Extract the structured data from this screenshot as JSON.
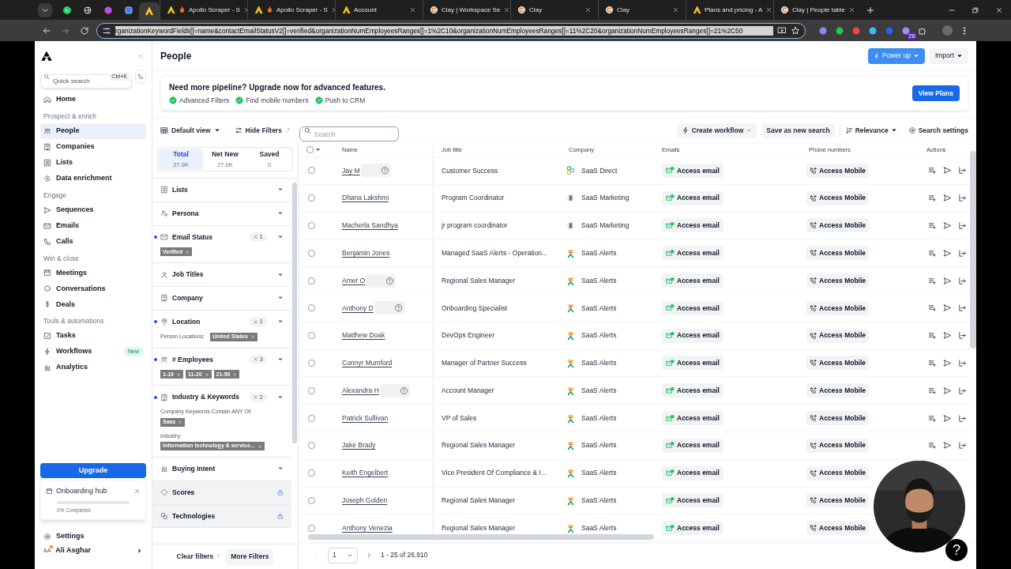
{
  "browser": {
    "pinned_tabs": [
      {
        "selected": false
      },
      {
        "selected": false
      },
      {
        "selected": false
      },
      {
        "selected": false
      },
      {
        "selected": true
      }
    ],
    "tabs": [
      {
        "title": "Apollo Scraper - S",
        "kind": "apollo-flame"
      },
      {
        "title": "Apollo Scraper - S",
        "kind": "apollo-flame"
      },
      {
        "title": "Account",
        "kind": "apollo"
      },
      {
        "title": "Clay | Workspace Se",
        "kind": "clay"
      },
      {
        "title": "Clay",
        "kind": "clay"
      },
      {
        "title": "Clay",
        "kind": "clay"
      },
      {
        "title": "Plans and pricing - A",
        "kind": "apollo"
      },
      {
        "title": "Clay | People table",
        "kind": "clay"
      }
    ],
    "url": "rganizationKeywordFields[]=name&contactEmailStatusV2[]=verified&organizationNumEmployeesRanges[]=1%2C10&organizationNumEmployeesRanges[]=11%2C20&organizationNumEmployeesRanges[]=21%2C50",
    "extension_badge": "26"
  },
  "sidebar": {
    "search": {
      "placeholder": "Quick search",
      "shortcut": "Ctrl+K"
    },
    "groups": [
      {
        "items": [
          {
            "label": "Home",
            "selected": false
          }
        ]
      },
      {
        "heading": "Prospect & enrich",
        "items": [
          {
            "label": "People",
            "selected": true
          },
          {
            "label": "Companies",
            "selected": false
          },
          {
            "label": "Lists",
            "selected": false
          },
          {
            "label": "Data enrichment",
            "selected": false
          }
        ]
      },
      {
        "heading": "Engage",
        "items": [
          {
            "label": "Sequences",
            "selected": false
          },
          {
            "label": "Emails",
            "selected": false
          },
          {
            "label": "Calls",
            "selected": false
          }
        ]
      },
      {
        "heading": "Win & close",
        "items": [
          {
            "label": "Meetings",
            "selected": false
          },
          {
            "label": "Conversations",
            "selected": false
          },
          {
            "label": "Deals",
            "selected": false
          }
        ]
      },
      {
        "heading": "Tools & automations",
        "items": [
          {
            "label": "Tasks",
            "selected": false
          },
          {
            "label": "Workflows",
            "selected": false,
            "badge": "New"
          },
          {
            "label": "Analytics",
            "selected": false
          }
        ]
      }
    ],
    "upgrade_button": "Upgrade",
    "onboarding": {
      "title": "Onboarding hub",
      "level": 0,
      "progress_text": "0% Completed"
    },
    "settings": "Settings",
    "user": {
      "initials": "AA",
      "name": "Ali Asghar"
    }
  },
  "header": {
    "title": "People",
    "power_up": "Power up",
    "import": "Import"
  },
  "banner": {
    "text": "Need more pipeline? Upgrade now for advanced features.",
    "features": [
      "Advanced Filters",
      "Find mobile numbers",
      "Push to CRM"
    ],
    "button": "View Plans"
  },
  "toolbar": {
    "view": "Default view",
    "hide_filters": "Hide Filters",
    "hide_filters_count": "7",
    "search_placeholder": "Search",
    "create_workflow": "Create workflow",
    "save_search": "Save as new search",
    "sort": "Relevance",
    "settings": "Search settings"
  },
  "stats": [
    {
      "label": "Total",
      "value": "27.0K",
      "selected": true
    },
    {
      "label": "Net New",
      "value": "27.0K",
      "selected": false
    },
    {
      "label": "Saved",
      "value": "0",
      "selected": false
    }
  ],
  "filters": [
    {
      "label": "Lists",
      "active": false,
      "locked": false
    },
    {
      "label": "Persona",
      "active": false,
      "locked": false
    },
    {
      "label": "Email Status",
      "active": true,
      "count": "1",
      "locked": false,
      "groups": [
        {
          "kind": "inline",
          "chips": [
            "Verified"
          ]
        }
      ]
    },
    {
      "label": "Job Titles",
      "active": false,
      "locked": false
    },
    {
      "label": "Company",
      "active": false,
      "locked": false
    },
    {
      "label": "Location",
      "active": true,
      "count": "1",
      "locked": false,
      "groups": [
        {
          "kind": "inline",
          "label": "Person Locations:",
          "chips": [
            "United States"
          ]
        }
      ]
    },
    {
      "label": "# Employees",
      "active": true,
      "count": "3",
      "locked": false,
      "groups": [
        {
          "kind": "inline",
          "chips": [
            "1-10",
            "11-20",
            "21-50"
          ]
        }
      ]
    },
    {
      "label": "Industry & Keywords",
      "active": true,
      "count": "2",
      "locked": false,
      "groups": [
        {
          "kind": "stacked",
          "label": "Company Keywords Contain ANY Of:",
          "chips": [
            "Saas"
          ]
        },
        {
          "kind": "stacked",
          "label": "Industry:",
          "chips": [
            "information technology & service..."
          ]
        }
      ]
    },
    {
      "label": "Buying Intent",
      "active": false,
      "locked": false
    },
    {
      "label": "Scores",
      "active": false,
      "locked": true
    },
    {
      "label": "Technologies",
      "active": false,
      "locked": true
    }
  ],
  "filter_footer": {
    "clear": "Clear filters",
    "clear_count": "7",
    "more": "More Filters"
  },
  "table": {
    "select_all": {
      "checked": false
    },
    "columns": [
      "Name",
      "Job title",
      "Company",
      "Emails",
      "Phone numbers",
      "Actions"
    ],
    "rows": [
      {
        "checked": false,
        "name": "Jay M",
        "blurred": true,
        "job": "Customer Success",
        "company": "SaaS Direct",
        "kind": "rings",
        "email": "Access email",
        "phone": "Access Mobile",
        "covered": false
      },
      {
        "checked": false,
        "name": "Dhana Lakshmi",
        "blurred": false,
        "job": "Program Coordinator",
        "company": "SaaS Marketing",
        "kind": "building",
        "email": "Access email",
        "phone": "Access Mobile",
        "covered": false
      },
      {
        "checked": false,
        "name": "Macherla Sandhya",
        "blurred": false,
        "job": "jr program coordinator",
        "company": "SaaS Marketing",
        "kind": "building",
        "email": "Access email",
        "phone": "Access Mobile",
        "covered": false
      },
      {
        "checked": false,
        "name": "Benjamin Jones",
        "blurred": false,
        "job": "Managed SaaS Alerts - Operation...",
        "company": "SaaS Alerts",
        "kind": "alerts",
        "email": "Access email",
        "phone": "Access Mobile",
        "covered": false
      },
      {
        "checked": false,
        "name": "Amer O",
        "blurred": true,
        "job": "Regional Sales Manager",
        "company": "SaaS Alerts",
        "kind": "alerts",
        "email": "Access email",
        "phone": "Access Mobile",
        "covered": false
      },
      {
        "checked": false,
        "name": "Anthony D",
        "blurred": true,
        "job": "Onboarding Specialist",
        "company": "SaaS Alerts",
        "kind": "alerts",
        "email": "Access email",
        "phone": "Access Mobile",
        "covered": false
      },
      {
        "checked": false,
        "name": "Matthew Doak",
        "blurred": false,
        "job": "DevOps Engineer",
        "company": "SaaS Alerts",
        "kind": "alerts",
        "email": "Access email",
        "phone": "Access Mobile",
        "covered": false
      },
      {
        "checked": false,
        "name": "Connyr Mumford",
        "blurred": false,
        "job": "Manager of Partner Success",
        "company": "SaaS Alerts",
        "kind": "alerts",
        "email": "Access email",
        "phone": "Access Mobile",
        "covered": false
      },
      {
        "checked": false,
        "name": "Alexandra H",
        "blurred": true,
        "job": "Account Manager",
        "company": "SaaS Alerts",
        "kind": "alerts",
        "email": "Access email",
        "phone": "Access Mobile",
        "covered": false
      },
      {
        "checked": false,
        "name": "Patrick Sullivan",
        "blurred": false,
        "job": "VP of Sales",
        "company": "SaaS Alerts",
        "kind": "alerts",
        "email": "Access email",
        "phone": "Access Mobile",
        "covered": false
      },
      {
        "checked": false,
        "name": "Jake Brady",
        "blurred": false,
        "job": "Regional Sales Manager",
        "company": "SaaS Alerts",
        "kind": "alerts",
        "email": "Access email",
        "phone": "Access Mobile",
        "covered": false
      },
      {
        "checked": false,
        "name": "Keith Engelbert",
        "blurred": false,
        "job": "Vice President Of Compliance & I...",
        "company": "SaaS Alerts",
        "kind": "alerts",
        "email": "Access email",
        "phone": "Access Mobile",
        "covered": true
      },
      {
        "checked": false,
        "name": "Joseph Golden",
        "blurred": false,
        "job": "Regional Sales Manager",
        "company": "SaaS Alerts",
        "kind": "alerts",
        "email": "Access email",
        "phone": "Access Mobile",
        "covered": true
      },
      {
        "checked": false,
        "name": "Anthony Venezia",
        "blurred": false,
        "job": "Regional Sales Manager",
        "company": "SaaS Alerts",
        "kind": "alerts",
        "email": "Access email",
        "phone": "Access Mobile",
        "covered": true
      }
    ]
  },
  "pagination": {
    "page": "1",
    "range": "1 - 25 of 26,910"
  },
  "help_button": "?"
}
